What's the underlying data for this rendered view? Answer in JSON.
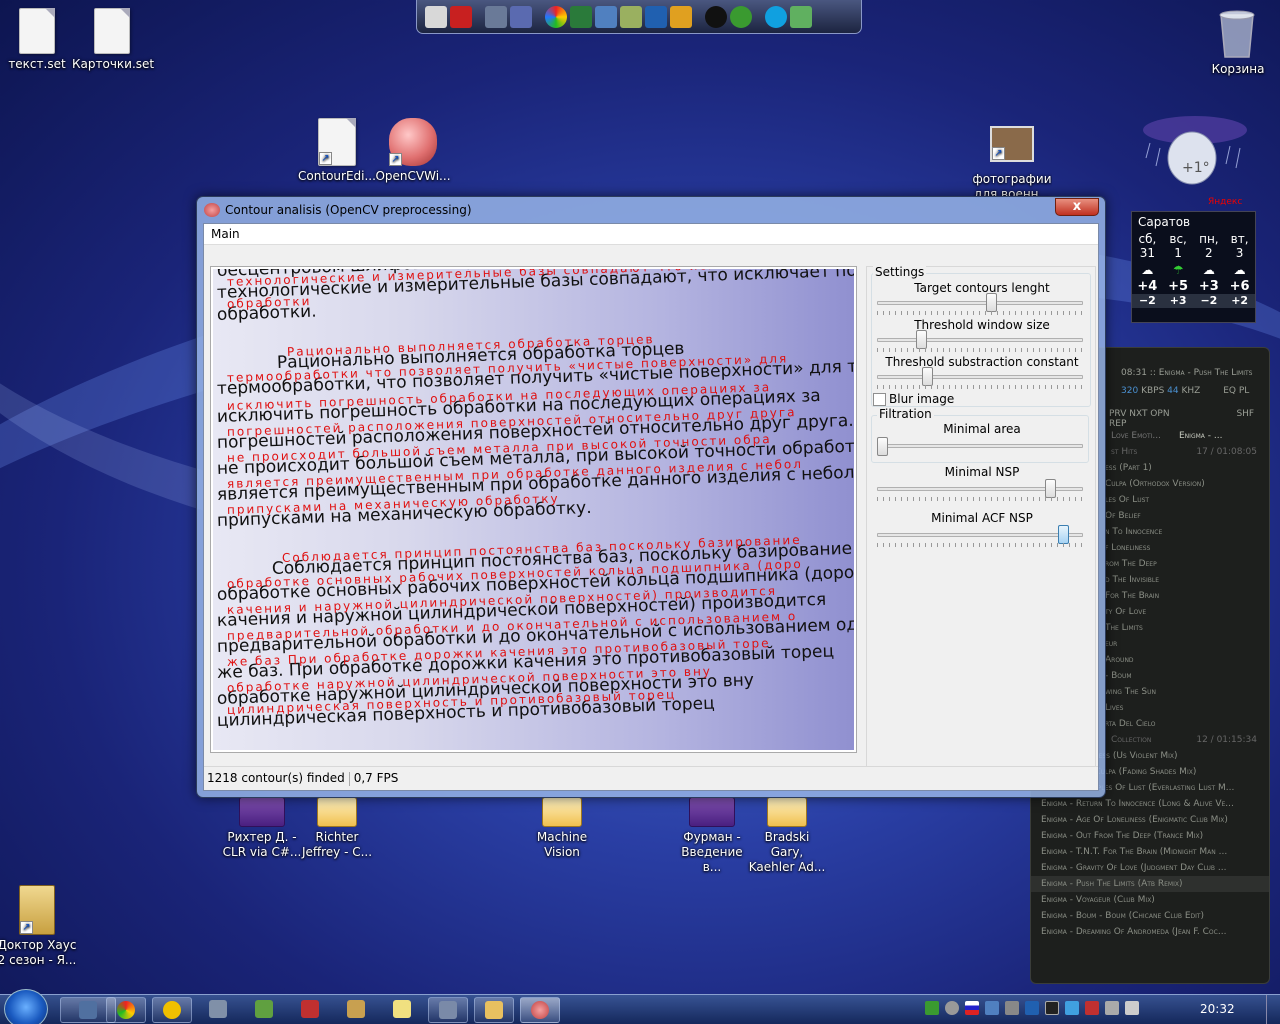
{
  "desktop": {
    "icons": [
      {
        "label": "текст.set"
      },
      {
        "label": "Карточки.set"
      },
      {
        "label": "ContourEdi..."
      },
      {
        "label": "OpenCVWi..."
      },
      {
        "label": "фотографии для военн..."
      },
      {
        "label": "Корзина"
      },
      {
        "label": "Рихтер Д. - CLR via C#..."
      },
      {
        "label": "Richter Jeffrey - C..."
      },
      {
        "label": "Machine Vision"
      },
      {
        "label": "Фурман - Введение в..."
      },
      {
        "label": "Bradski Gary, Kaehler Ad..."
      },
      {
        "label": "Доктор Хаус 2 сезон - Я..."
      }
    ]
  },
  "weather": {
    "temp_now": "+1°",
    "brand": "Яндекс",
    "city": "Саратов",
    "days": [
      {
        "dow": "сб,",
        "date": "31",
        "hi": "+4",
        "lo": "−2"
      },
      {
        "dow": "вс,",
        "date": "1",
        "hi": "+5",
        "lo": "+3"
      },
      {
        "dow": "пн,",
        "date": "2",
        "hi": "+3",
        "lo": "−2"
      },
      {
        "dow": "вт,",
        "date": "3",
        "hi": "+6",
        "lo": "+2"
      }
    ]
  },
  "player": {
    "now_playing": "08:31 :: Enigma - Push The Limits",
    "bitrate": "320",
    "khz": "44",
    "kbps_label": "KBPS",
    "khz_label": "KHZ",
    "eq_label": "EQ",
    "pl_label": "PL",
    "controls": "PRV NXT OPN",
    "controls_right": "SHF REP",
    "playlist_header": "Enigma - ...",
    "playlist_header_left": "Love Emoti...",
    "group1": {
      "label": "st Hits",
      "info": "17 / 01:08:05"
    },
    "tracks1": [
      "ess (Part 1)",
      "Culpa (Orthodox Version)",
      "les Of Lust",
      "Of Belief",
      "n To Innocence",
      "f Loneliness",
      "rom The Deep",
      "d The Invisible",
      "For The Brain",
      "ty Of Love",
      "The Limits",
      "eur",
      "Around",
      "- Boum",
      "wing The Sun",
      "Lives",
      "rta Del Cielo"
    ],
    "group2": {
      "label": "Collection",
      "info": "12 / 01:15:34"
    },
    "tracks2": [
      "Enigma - Sadeness (Us Violent Mix)",
      "Enigma - Mea Culpa (Fading Shades Mix)",
      "Enigma - Principles Of Lust (Everlasting Lust M...",
      "Enigma - Return To Innocence (Long & Alive Ve...",
      "Enigma - Age Of Loneliness (Enigmatic Club Mix)",
      "Enigma - Out From The Deep (Trance Mix)",
      "Enigma - T.N.T. For The Brain (Midnight Man ...",
      "Enigma - Gravity Of Love (Judgment Day Club ...",
      "Enigma - Push The Limits (Atb Remix)",
      "Enigma - Voyageur (Club Mix)",
      "Enigma - Boum - Boum (Chicane Club Edit)",
      "Enigma - Dreaming Of Andromeda (Jean F. Coc..."
    ]
  },
  "window": {
    "title": "Contour analisis (OpenCV preprocessing)",
    "close": "x",
    "menu": {
      "main": "Main"
    },
    "image_text": [
      "бесцентровом шлифовании, шлифовании и противобазового",
      "технологические и измерительные базы совпадают, что исключает погре",
      "обработки.",
      "Рационально выполняется обработка торцев",
      "термообработки, что позволяет получить «чистые поверхности» для того,",
      "исключить погрешность обработки на последующих операциях за",
      "погрешностей расположения поверхностей относительно друг друга. При",
      "не происходит большой съем металла, при высокой точности обработк",
      "является преимущественным при обработке данного изделия с небол",
      "припусками на механическую обработку.",
      "Соблюдается принцип постоянства баз, поскольку базирование",
      "обработке основных рабочих поверхностей кольца подшипника (доро",
      "качения и наружной цилиндрической поверхностей) производится",
      "предварительной обработки и до окончательной с использованием одних",
      "же баз. При обработке дорожки качения это противобазовый торец",
      "обработке наружной цилиндрической поверхности это вну",
      "цилиндрическая поверхность и противобазовый торец"
    ],
    "settings": {
      "group_label": "Settings",
      "target_contours_label": "Target contours lenght",
      "target_contours_value": 0.56,
      "threshold_window_label": "Threshold window size",
      "threshold_window_value": 0.2,
      "threshold_const_label": "Threshold substraction constant",
      "threshold_const_value": 0.23,
      "blur_label": "Blur image",
      "blur_checked": false,
      "filtration_label": "Filtration",
      "min_area_label": "Minimal area",
      "min_area_value": 0.0,
      "min_nsp_label": "Minimal NSP",
      "min_nsp_value": 0.86,
      "min_acf_label": "Minimal ACF NSP",
      "min_acf_value": 0.93
    },
    "status": {
      "contours": "1218 contour(s) finded",
      "fps": "0,7 FPS"
    }
  },
  "taskbar": {
    "clock": "20:32"
  }
}
